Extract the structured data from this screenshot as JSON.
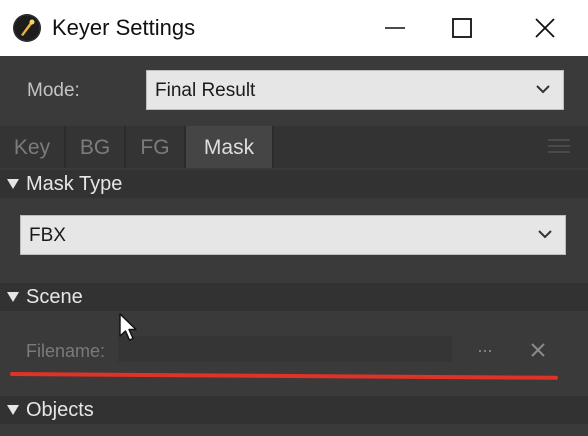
{
  "window": {
    "title": "Keyer Settings",
    "icon": "keyer-app-icon"
  },
  "mode": {
    "label": "Mode:",
    "value": "Final Result"
  },
  "tabs": [
    {
      "label": "Key",
      "active": false
    },
    {
      "label": "BG",
      "active": false
    },
    {
      "label": "FG",
      "active": false
    },
    {
      "label": "Mask",
      "active": true
    }
  ],
  "sections": {
    "mask_type": {
      "title": "Mask Type",
      "value": "FBX"
    },
    "scene": {
      "title": "Scene",
      "filename_label": "Filename:",
      "filename_value": "",
      "browse_label": "...",
      "clear_icon": "close-icon"
    },
    "objects": {
      "title": "Objects"
    }
  },
  "colors": {
    "annotation_underline": "#e03226",
    "panel_bg": "#3a3a3a"
  }
}
